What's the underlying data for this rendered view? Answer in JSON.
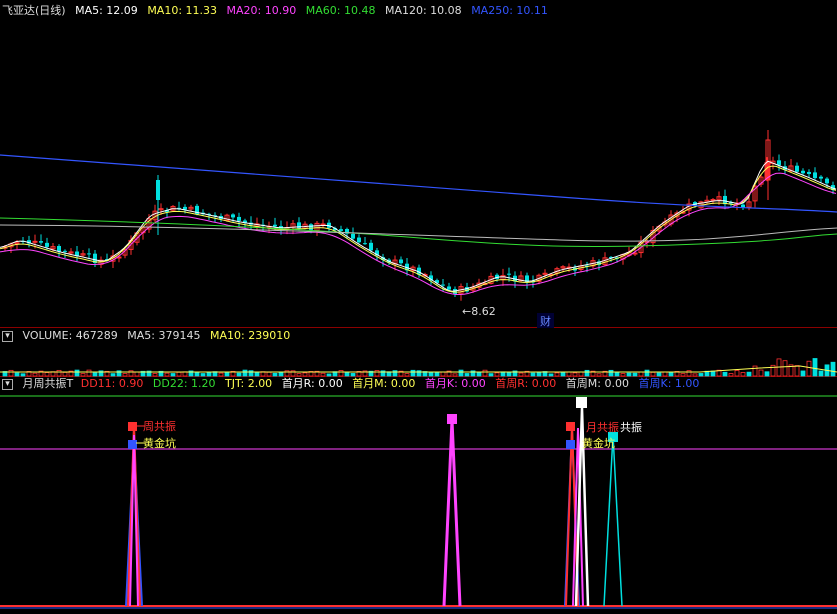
{
  "price_panel": {
    "title": "飞亚达(日线)",
    "legend": [
      {
        "label": "MA5: 12.09",
        "color": "#ffffff"
      },
      {
        "label": "MA10: 11.33",
        "color": "#ffff55"
      },
      {
        "label": "MA20: 10.90",
        "color": "#ff44ff"
      },
      {
        "label": "MA60: 10.48",
        "color": "#33dd33"
      },
      {
        "label": "MA120: 10.08",
        "color": "#dddddd"
      },
      {
        "label": "MA250: 10.11",
        "color": "#3355ff"
      }
    ],
    "low_marker": "8.62",
    "cai_badge": "财"
  },
  "volume_panel": {
    "legend": [
      {
        "label": "VOLUME: 467289",
        "color": "#dddddd"
      },
      {
        "label": "MA5: 379145",
        "color": "#dddddd"
      },
      {
        "label": "MA10: 239010",
        "color": "#ffff55"
      }
    ]
  },
  "indicator_panel": {
    "title": "月周共振T",
    "legend": [
      {
        "label": "DD11: 0.90",
        "color": "#ff3030"
      },
      {
        "label": "DD22: 1.20",
        "color": "#33dd33"
      },
      {
        "label": "TJT: 2.00",
        "color": "#ffff55"
      },
      {
        "label": "首月R: 0.00",
        "color": "#ffffff"
      },
      {
        "label": "首月M: 0.00",
        "color": "#ffff55"
      },
      {
        "label": "首月K: 0.00",
        "color": "#ff44ff"
      },
      {
        "label": "首周R: 0.00",
        "color": "#ff3030"
      },
      {
        "label": "首周M: 0.00",
        "color": "#dddddd"
      },
      {
        "label": "首周K: 1.00",
        "color": "#3355ff"
      }
    ],
    "annotations": {
      "week_resonance": "周共振",
      "golden_pit": "黄金坑",
      "golden_pit_2": "黄金坑",
      "month_resonance": "月共振",
      "resonance_tail": "共振"
    }
  },
  "colors": {
    "up": "#ff3030",
    "down": "#00e0e0",
    "background": "#000000"
  },
  "chart_data": {
    "type": "line",
    "series": [
      {
        "name": "MA5",
        "last": 12.09
      },
      {
        "name": "MA10",
        "last": 11.33
      },
      {
        "name": "MA20",
        "last": 10.9
      },
      {
        "name": "MA60",
        "last": 10.48
      },
      {
        "name": "MA120",
        "last": 10.08
      },
      {
        "name": "MA250",
        "last": 10.11
      }
    ],
    "volume": {
      "VOLUME": 467289,
      "MA5": 379145,
      "MA10": 239010
    },
    "indicator": {
      "DD11": 0.9,
      "DD22": 1.2,
      "TJT": 2.0,
      "首月R": 0.0,
      "首月M": 0.0,
      "首月K": 0.0,
      "首周R": 0.0,
      "首周M": 0.0,
      "首周K": 1.0
    },
    "low_price_label": 8.62
  }
}
